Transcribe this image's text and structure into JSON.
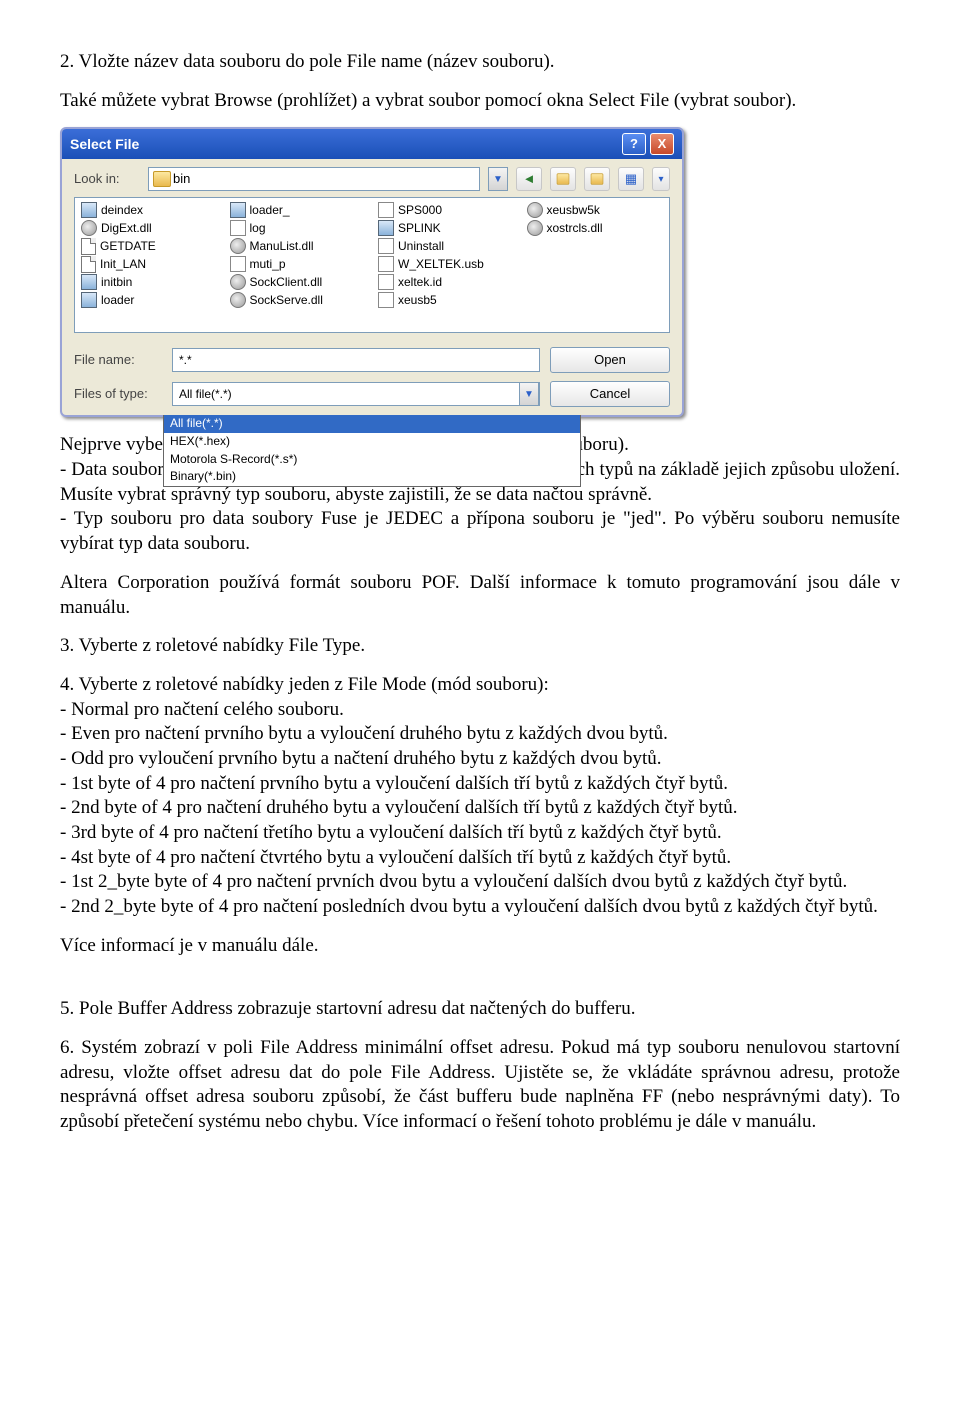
{
  "p1": "2. Vložte název data souboru do pole File name (název souboru).",
  "p2": "Také můžete vybrat Browse (prohlížet) a vybrat soubor pomocí okna Select File (vybrat soubor).",
  "dialog": {
    "title": "Select File",
    "lookin_label": "Look in:",
    "lookin_value": "bin",
    "help_char": "?",
    "close_char": "X",
    "cols": [
      [
        {
          "icon": "box",
          "name": "deindex"
        },
        {
          "icon": "gear",
          "name": "DigExt.dll"
        },
        {
          "icon": "page",
          "name": "GETDATE"
        },
        {
          "icon": "page",
          "name": "Init_LAN"
        },
        {
          "icon": "box",
          "name": "initbin"
        },
        {
          "icon": "box",
          "name": "loader"
        }
      ],
      [
        {
          "icon": "box",
          "name": "loader_"
        },
        {
          "icon": "file",
          "name": "log"
        },
        {
          "icon": "gear",
          "name": "ManuList.dll"
        },
        {
          "icon": "file",
          "name": "muti_p"
        },
        {
          "icon": "gear",
          "name": "SockClient.dll"
        },
        {
          "icon": "gear",
          "name": "SockServe.dll"
        }
      ],
      [
        {
          "icon": "file",
          "name": "SPS000"
        },
        {
          "icon": "box",
          "name": "SPLINK"
        },
        {
          "icon": "file",
          "name": "Uninstall"
        },
        {
          "icon": "file",
          "name": "W_XELTEK.usb"
        },
        {
          "icon": "file",
          "name": "xeltek.id"
        },
        {
          "icon": "file",
          "name": "xeusb5"
        }
      ],
      [
        {
          "icon": "gear",
          "name": "xeusbw5k"
        },
        {
          "icon": "gear",
          "name": "xostrcls.dll"
        }
      ]
    ],
    "filename_label": "File name:",
    "filename_value": "*.*",
    "filetype_label": "Files of type:",
    "filetype_value": "All file(*.*)",
    "open_btn": "Open",
    "cancel_btn": "Cancel",
    "dd_1": "All file(*.*)",
    "dd_2": "HEX(*.hex)",
    "dd_3": "Motorola S-Record(*.s*)",
    "dd_4": "Binary(*.bin)"
  },
  "p3": "Nejprve vyberte typ souborů z roletové nabídky File of type (typ souboru).",
  "p4": "- Data soubory (HEX/ASCII data) lze dále rozdělit do mnoha různých typů na základě jejich způsobu uložení. Musíte vybrat správný typ souboru, abyste zajistili, že se data načtou správně.",
  "p5": "- Typ souboru pro data soubory Fuse je JEDEC a přípona souboru je \"jed\". Po výběru souboru nemusíte vybírat typ data souboru.",
  "p6": "Altera Corporation používá formát souboru POF. Další informace k tomuto programování jsou dále v manuálu.",
  "p7": "3. Vyberte z roletové nabídky File Type.",
  "p8": "4. Vyberte z roletové nabídky jeden z File Mode (mód souboru):",
  "l1": "- Normal pro načtení celého souboru.",
  "l2": "- Even pro načtení prvního bytu a vyloučení druhého bytu z každých dvou bytů.",
  "l3": "- Odd pro vyloučení prvního bytu a načtení druhého bytu z každých dvou bytů.",
  "l4": "- 1st byte of 4 pro načtení prvního bytu a vyloučení dalších tří bytů z každých čtyř bytů.",
  "l5": "- 2nd byte of 4 pro načtení druhého bytu a vyloučení dalších tří bytů z každých čtyř bytů.",
  "l6": "- 3rd byte of 4 pro načtení třetího bytu a vyloučení dalších tří bytů z každých čtyř bytů.",
  "l7": "- 4st byte of 4 pro načtení čtvrtého bytu a vyloučení dalších tří bytů z každých čtyř bytů.",
  "l8": "- 1st 2_byte byte of 4 pro načtení prvních dvou bytu a vyloučení dalších dvou bytů z každých čtyř bytů.",
  "l9": "- 2nd 2_byte byte of 4 pro načtení posledních dvou bytu a vyloučení dalších dvou bytů z každých čtyř bytů.",
  "p9": "Více informací je v manuálu dále.",
  "p10": "5. Pole Buffer Address zobrazuje startovní adresu dat načtených do bufferu.",
  "p11": "6. Systém zobrazí v poli File Address minimální offset adresu. Pokud má typ souboru nenulovou startovní adresu, vložte offset adresu dat do pole File Address. Ujistěte se, že vkládáte správnou adresu, protože nesprávná offset adresa souboru způsobí, že část bufferu bude naplněna FF (nebo nesprávnými daty). To způsobí přetečení systému nebo chybu. Více informací o řešení tohoto problému je dále v manuálu."
}
